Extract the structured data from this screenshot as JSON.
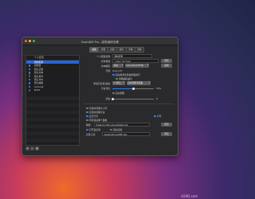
{
  "window": {
    "title": "ExamDiff Pro - 选项/偏好设置"
  },
  "sidebar": {
    "header": "个人配置",
    "items": [
      {
        "label": "我的配置",
        "checked": true,
        "selected": true
      },
      {
        "label": "新配置",
        "checked": true,
        "selected": false
      },
      {
        "label": "默认比较",
        "checked": true,
        "selected": false
      },
      {
        "label": "默认文本",
        "checked": true,
        "selected": false
      },
      {
        "label": "默认目录",
        "checked": false,
        "selected": false
      },
      {
        "label": "默认XML",
        "checked": true,
        "selected": false
      },
      {
        "label": "默认编码",
        "checked": true,
        "selected": false
      },
      {
        "label": "Unicode",
        "checked": true,
        "selected": false
      },
      {
        "label": "Build",
        "checked": false,
        "selected": false
      }
    ],
    "tools": [
      "+",
      "−",
      "⚙"
    ]
  },
  "tabs": [
    "常规",
    "比较",
    "过滤",
    "显示",
    "字体",
    "文件"
  ],
  "form": {
    "profile_label": "个人配置名称:",
    "profile_value": "我的配置",
    "file_type_label": "文件类型:",
    "file_type_value": "*.cpp;*.h;*.hpp",
    "browse_label": "浏览",
    "encoding_label": "文本编码:",
    "encoding_value": "自动",
    "encoding_option": "Unicode (UTF-8)",
    "options_btn": "选项",
    "line_label": "行尾:",
    "line_value": "Unix (LF)",
    "detect_label": "自动检测文件编码和换行",
    "detect_sub": "忽略编码差异",
    "tab_width_label": "制表符宽度/缩进:",
    "tab_width_value": "4 (默认)",
    "tab_width_option": "应用到所有面板",
    "space_label": "空白对比:",
    "space_value": "50",
    "space_unit": "%",
    "auto_label": "自动调整",
    "compare_label": "比较:",
    "compare_value": "0",
    "check1": "比较时忽略大小写",
    "check2": "比较时忽略空白",
    "check3": "显示行号",
    "check3_opt": "行号",
    "check4": "同步滚动两个面板",
    "path1_label": "路径:",
    "path1_value": "/Users/cc/Documents/test.cpp",
    "path1_btn": "浏览",
    "radio1": "打开后比较",
    "radio2": "自动比较",
    "path2_label": "比较工具:",
    "path2_value": "/Applications/Diff.app",
    "path2_btn": "浏览"
  },
  "watermark": "LO4D.com"
}
